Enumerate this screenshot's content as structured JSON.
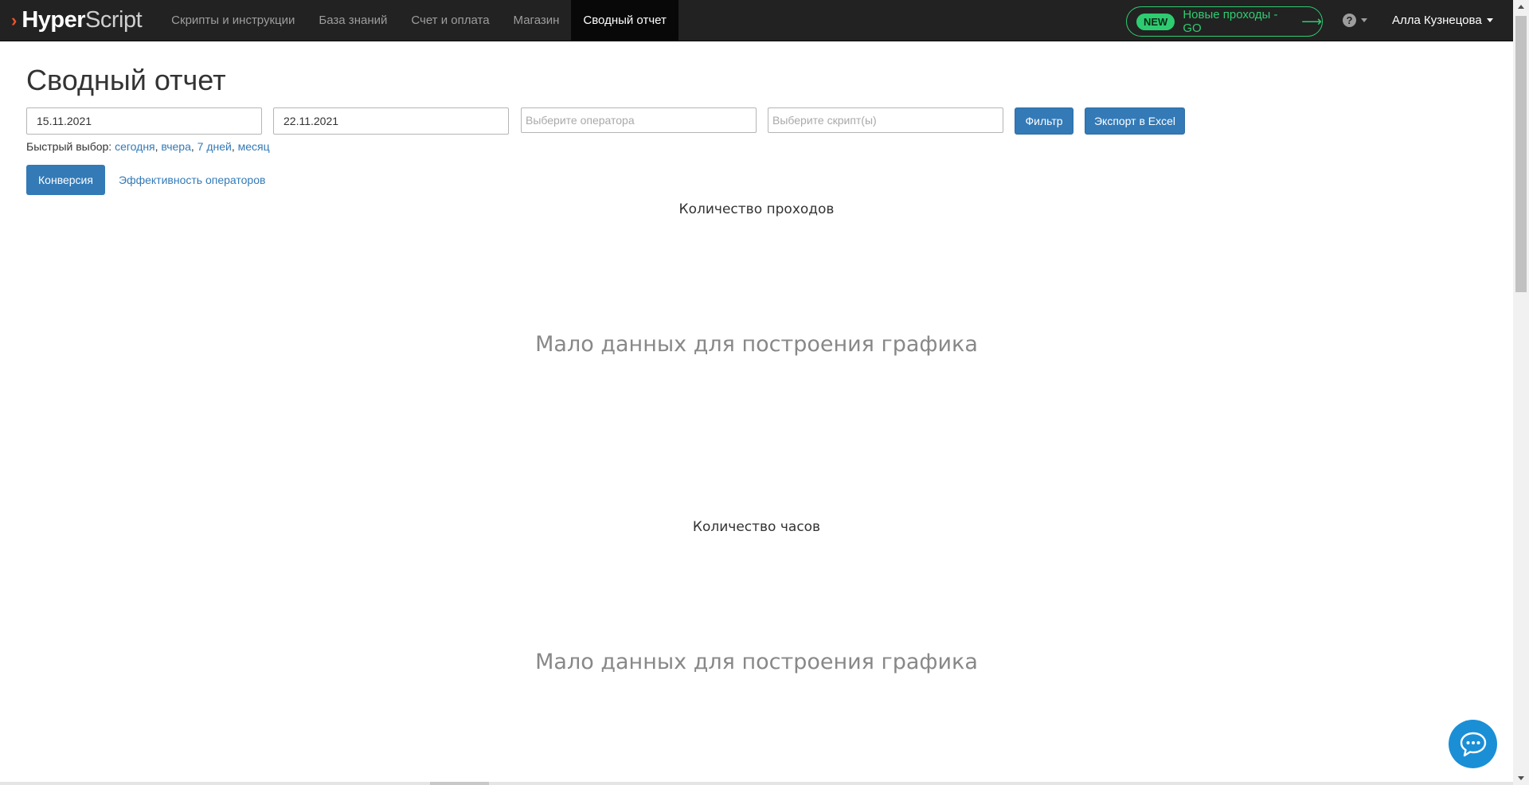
{
  "brand": {
    "name_bold": "Hyper",
    "name_light": "Script"
  },
  "nav": {
    "items": [
      {
        "label": "Скрипты и инструкции"
      },
      {
        "label": "База знаний"
      },
      {
        "label": "Счет и оплата"
      },
      {
        "label": "Магазин"
      },
      {
        "label": "Сводный отчет",
        "active": true
      }
    ]
  },
  "promo": {
    "badge": "NEW",
    "text": "Новые проходы - GO",
    "arrow": "⟶"
  },
  "help": {
    "icon": "question-circle-icon",
    "glyph": "?"
  },
  "user": {
    "name": "Алла Кузнецова"
  },
  "page": {
    "title": "Сводный отчет"
  },
  "filters": {
    "date_from": "15.11.2021",
    "date_to": "22.11.2021",
    "operator_placeholder": "Выберите оператора",
    "script_placeholder": "Выберите скрипт(ы)",
    "filter_button": "Фильтр",
    "export_button": "Экспорт в Excel"
  },
  "quick_select": {
    "label": "Быстрый выбор:",
    "options": [
      "сегодня",
      "вчера",
      "7 дней",
      "месяц"
    ]
  },
  "tabs": {
    "active": "Конверсия",
    "other": "Эффективность операторов"
  },
  "charts": [
    {
      "title": "Количество проходов",
      "empty_message": "Мало данных для построения графика"
    },
    {
      "title": "Количество часов",
      "empty_message": "Мало данных для построения графика"
    }
  ],
  "colors": {
    "navbar": "#222222",
    "primary": "#337ab7",
    "promo_green": "#2ecc71",
    "chat": "#1a8fd6"
  }
}
